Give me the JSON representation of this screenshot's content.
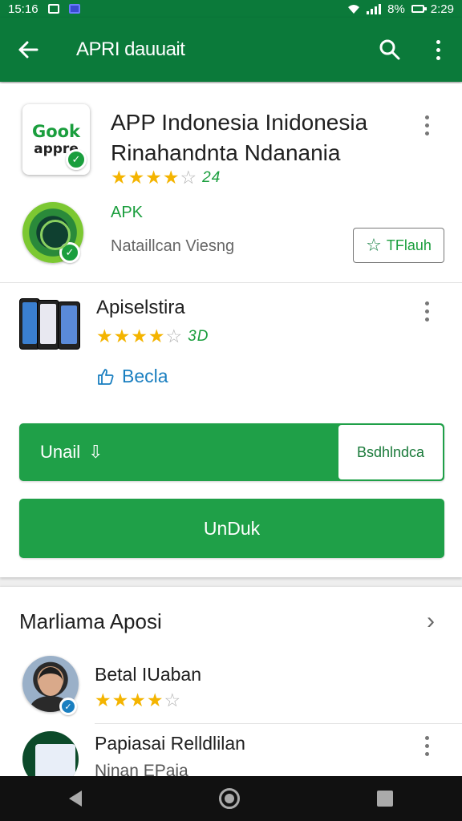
{
  "status_bar": {
    "time": "15:16",
    "battery": "8%",
    "clock_right": "2:29"
  },
  "app_bar": {
    "title": "APRI dauuait"
  },
  "main_app": {
    "logo_line1": "Gook",
    "logo_line2": "appre",
    "title": "APP Indonesia Inidonesia Rinahandnta Ndanania",
    "rating": 4,
    "rating_count": "24",
    "type_label": "APK",
    "subtitle": "Nataillcan Viesng",
    "wishlist_label": "TFlauh"
  },
  "secondary_app": {
    "title": "Apiselstira",
    "rating": 4,
    "rating_count": "3D",
    "like_label": "Becla"
  },
  "install": {
    "label": "Unail",
    "side_label": "Bsdhlndca"
  },
  "open_button": {
    "label": "UnDuk"
  },
  "reviews": {
    "section_title": "Marliama Aposi",
    "items": [
      {
        "name": "Betal IUaban",
        "rating": 4
      },
      {
        "name": "Papiasai Relldlilan",
        "sub": "Ninan EPaja"
      }
    ]
  },
  "colors": {
    "primary": "#0b7a3a",
    "button": "#1fa048",
    "star": "#f4b400"
  }
}
